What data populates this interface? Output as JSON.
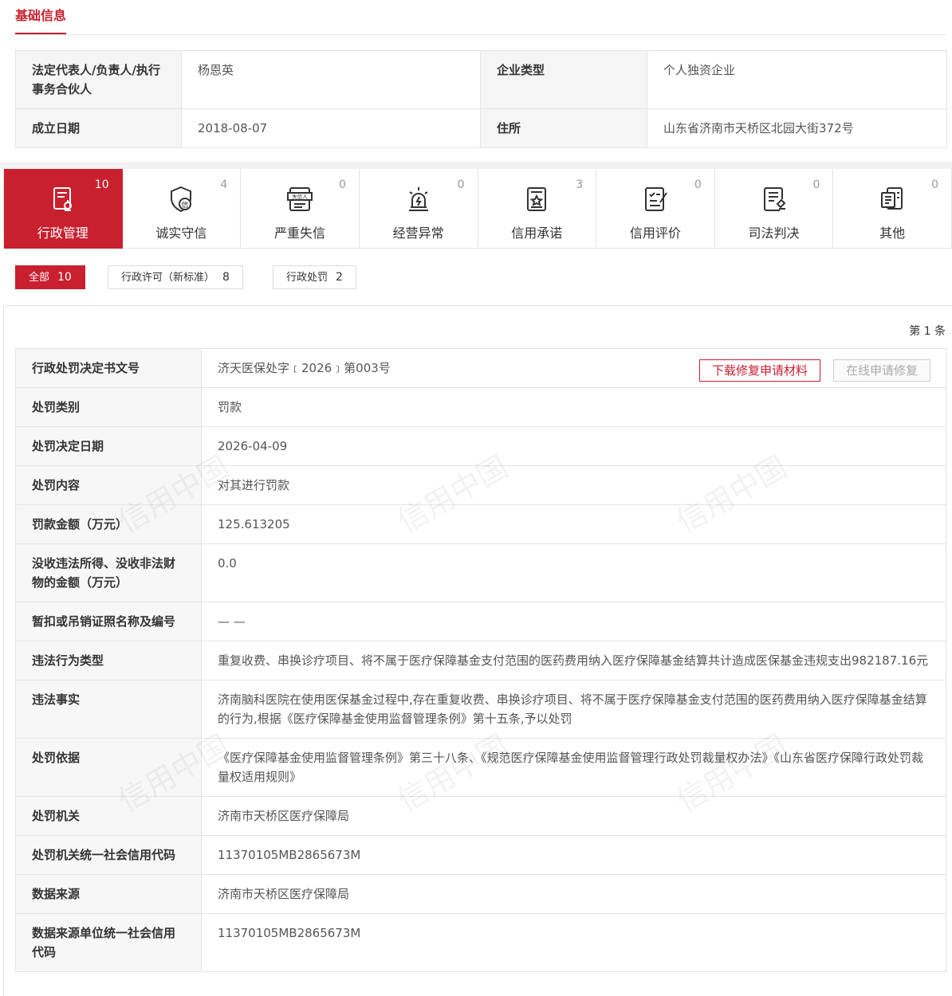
{
  "basic": {
    "title": "基础信息",
    "rows": [
      {
        "k1": "法定代表人/负责人/执行事务合伙人",
        "v1": "杨恩英",
        "k2": "企业类型",
        "v2": "个人独资企业"
      },
      {
        "k1": "成立日期",
        "v1": "2018-08-07",
        "k2": "住所",
        "v2": "山东省济南市天桥区北园大街372号"
      }
    ]
  },
  "categories": [
    {
      "label": "行政管理",
      "count": "10",
      "icon": "admin-management-icon",
      "active": true
    },
    {
      "label": "诚实守信",
      "count": "4",
      "icon": "trust-shield-icon"
    },
    {
      "label": "严重失信",
      "count": "0",
      "icon": "dishonest-icon"
    },
    {
      "label": "经营异常",
      "count": "0",
      "icon": "alarm-light-icon"
    },
    {
      "label": "信用承诺",
      "count": "3",
      "icon": "commitment-icon"
    },
    {
      "label": "信用评价",
      "count": "0",
      "icon": "evaluation-icon"
    },
    {
      "label": "司法判决",
      "count": "0",
      "icon": "judicial-icon"
    },
    {
      "label": "其他",
      "count": "0",
      "icon": "other-icon"
    }
  ],
  "category_icon_badge": "失信人",
  "trust_icon_char": "信",
  "filters": [
    {
      "label": "全部",
      "count": "10",
      "active": true
    },
    {
      "label": "行政许可（新标准）",
      "count": "8"
    },
    {
      "label": "行政处罚",
      "count": "2"
    }
  ],
  "record_count": "第 1 条",
  "buttons": {
    "download": "下载修复申请材料",
    "online": "在线申请修复"
  },
  "detail_rows": [
    {
      "k": "行政处罚决定书文号",
      "v": "济天医保处字﹝2026﹞第003号"
    },
    {
      "k": "处罚类别",
      "v": "罚款"
    },
    {
      "k": "处罚决定日期",
      "v": "2026-04-09"
    },
    {
      "k": "处罚内容",
      "v": "对其进行罚款"
    },
    {
      "k": "罚款金额（万元）",
      "v": "125.613205"
    },
    {
      "k": "没收违法所得、没收非法财物的金额（万元）",
      "v": "0.0"
    },
    {
      "k": "暂扣或吊销证照名称及编号",
      "v": "— —"
    },
    {
      "k": "违法行为类型",
      "v": "重复收费、串换诊疗项目、将不属于医疗保障基金支付范围的医药费用纳入医疗保障基金结算共计造成医保基金违规支出982187.16元"
    },
    {
      "k": "违法事实",
      "v": "济南脑科医院在使用医保基金过程中,存在重复收费、串换诊疗项目、将不属于医疗保障基金支付范围的医药费用纳入医疗保障基金结算的行为,根据《医疗保障基金使用监督管理条例》第十五条,予以处罚"
    },
    {
      "k": "处罚依据",
      "v": "《医疗保障基金使用监督管理条例》第三十八条、《规范医疗保障基金使用监督管理行政处罚裁量权办法》《山东省医疗保障行政处罚裁量权适用规则》"
    },
    {
      "k": "处罚机关",
      "v": "济南市天桥区医疗保障局"
    },
    {
      "k": "处罚机关统一社会信用代码",
      "v": "11370105MB2865673M"
    },
    {
      "k": "数据来源",
      "v": "济南市天桥区医疗保障局"
    },
    {
      "k": "数据来源单位统一社会信用代码",
      "v": "11370105MB2865673M"
    }
  ],
  "watermark": "信用中国",
  "colors": {
    "accent": "#c8202f",
    "label_bg": "#f7f7f7",
    "border": "#e4e4e4"
  }
}
